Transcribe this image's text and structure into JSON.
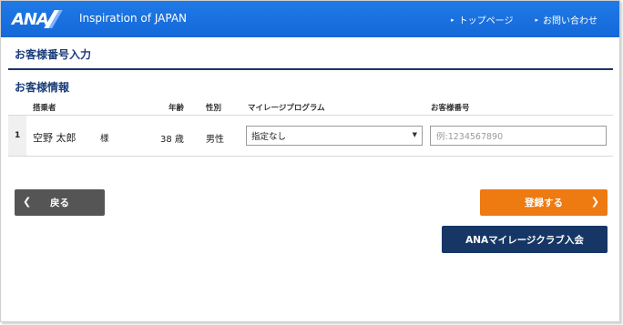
{
  "header": {
    "logo_text": "ANA",
    "tagline": "Inspiration of JAPAN",
    "nav": [
      {
        "label": "トップページ"
      },
      {
        "label": "お問い合わせ"
      }
    ]
  },
  "page_title": "お客様番号入力",
  "section_title": "お客様情報",
  "table": {
    "headers": {
      "passenger": "搭乗者",
      "age": "年齢",
      "gender": "性別",
      "mileage_program": "マイレージプログラム",
      "customer_number": "お客様番号"
    },
    "rows": [
      {
        "index": "1",
        "name": "空野 太郎",
        "honorific": "様",
        "age": "38 歳",
        "gender": "男性",
        "program_selected": "指定なし",
        "customer_number_placeholder": "例:1234567890"
      }
    ]
  },
  "buttons": {
    "back": "戻る",
    "register": "登録する",
    "join": "ANAマイレージクラブ入会"
  },
  "colors": {
    "header_blue": "#1a6fe0",
    "title_navy": "#1b3c7a",
    "register_orange": "#ee7a12",
    "join_navy": "#163766",
    "back_gray": "#555555"
  }
}
